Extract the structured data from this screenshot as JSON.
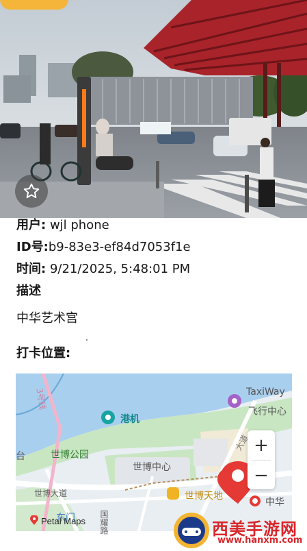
{
  "photo": {
    "alt": "中华艺术宫"
  },
  "favorite": {
    "icon": "star-outline-icon"
  },
  "info": {
    "user_label": "用户:",
    "user_value": "wjl phone",
    "id_label": "ID号:",
    "id_value": "b9-83e3-ef84d7053f1e",
    "time_label": "时间:",
    "time_value": "9/21/2025, 5:48:01 PM",
    "desc_label": "描述",
    "desc_value": "中华艺术宫",
    "checkin_label": "打卡位置:"
  },
  "map": {
    "labels": {
      "taxiway": "TaxiWay",
      "flight_center": "飞行中心",
      "airport": "港机",
      "expo_park": "世博公园",
      "expo_center": "世博中心",
      "expo_avenue": "世博大道",
      "expo_plaza": "世博天地",
      "china": "中华",
      "east_gate": "东门",
      "line3": "3号线",
      "tai": "台",
      "xiuxiang": "秀",
      "guoyao": "国耀路",
      "shibo_road": "世博",
      "road_dao": "大道"
    },
    "zoom_in": "+",
    "zoom_out": "−",
    "attribution": "Petal Maps"
  },
  "watermark": {
    "title": "西美手游网",
    "url": "www.hanxm.com"
  },
  "colors": {
    "accent_red": "#e53935",
    "building_red": "#a8232a",
    "water": "#a9cfee",
    "park": "#c9e6c3"
  }
}
